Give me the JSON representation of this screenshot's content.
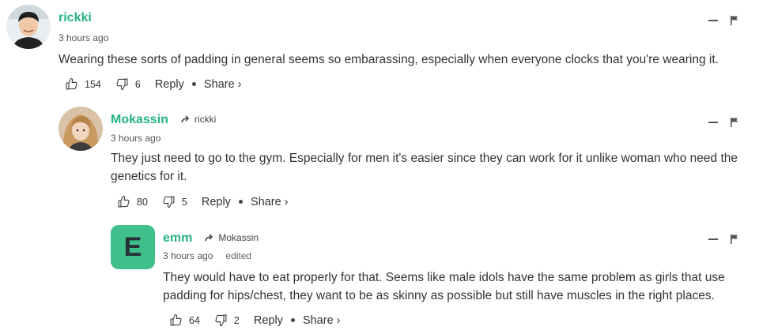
{
  "comments": [
    {
      "author": "rickki",
      "time": "3 hours ago",
      "text": "Wearing these sorts of padding in general seems so embarassing, especially when everyone clocks that you're wearing it.",
      "likes": "154",
      "dislikes": "6",
      "reply_label": "Reply",
      "share_label": "Share ›"
    },
    {
      "author": "Mokassin",
      "reply_to": "rickki",
      "time": "3 hours ago",
      "text": "They just need to go to the gym. Especially for men it's easier since they can work for it unlike woman who need the genetics for it.",
      "likes": "80",
      "dislikes": "5",
      "reply_label": "Reply",
      "share_label": "Share ›"
    },
    {
      "author": "emm",
      "avatar_letter": "E",
      "reply_to": "Mokassin",
      "time": "3 hours ago",
      "edited": "edited",
      "text": "They would have to eat properly for that. Seems like male idols have the same problem as girls that use padding for hips/chest, they want to be as skinny as possible but still have muscles in the right places.",
      "likes": "64",
      "dislikes": "2",
      "reply_label": "Reply",
      "share_label": "Share ›"
    }
  ],
  "colors": {
    "author": "#24b47e",
    "letter_avatar_bg": "#3fbf8a"
  },
  "icons": [
    "thumbs-up-icon",
    "thumbs-down-icon",
    "reply-arrow-icon",
    "collapse-icon",
    "flag-icon"
  ]
}
